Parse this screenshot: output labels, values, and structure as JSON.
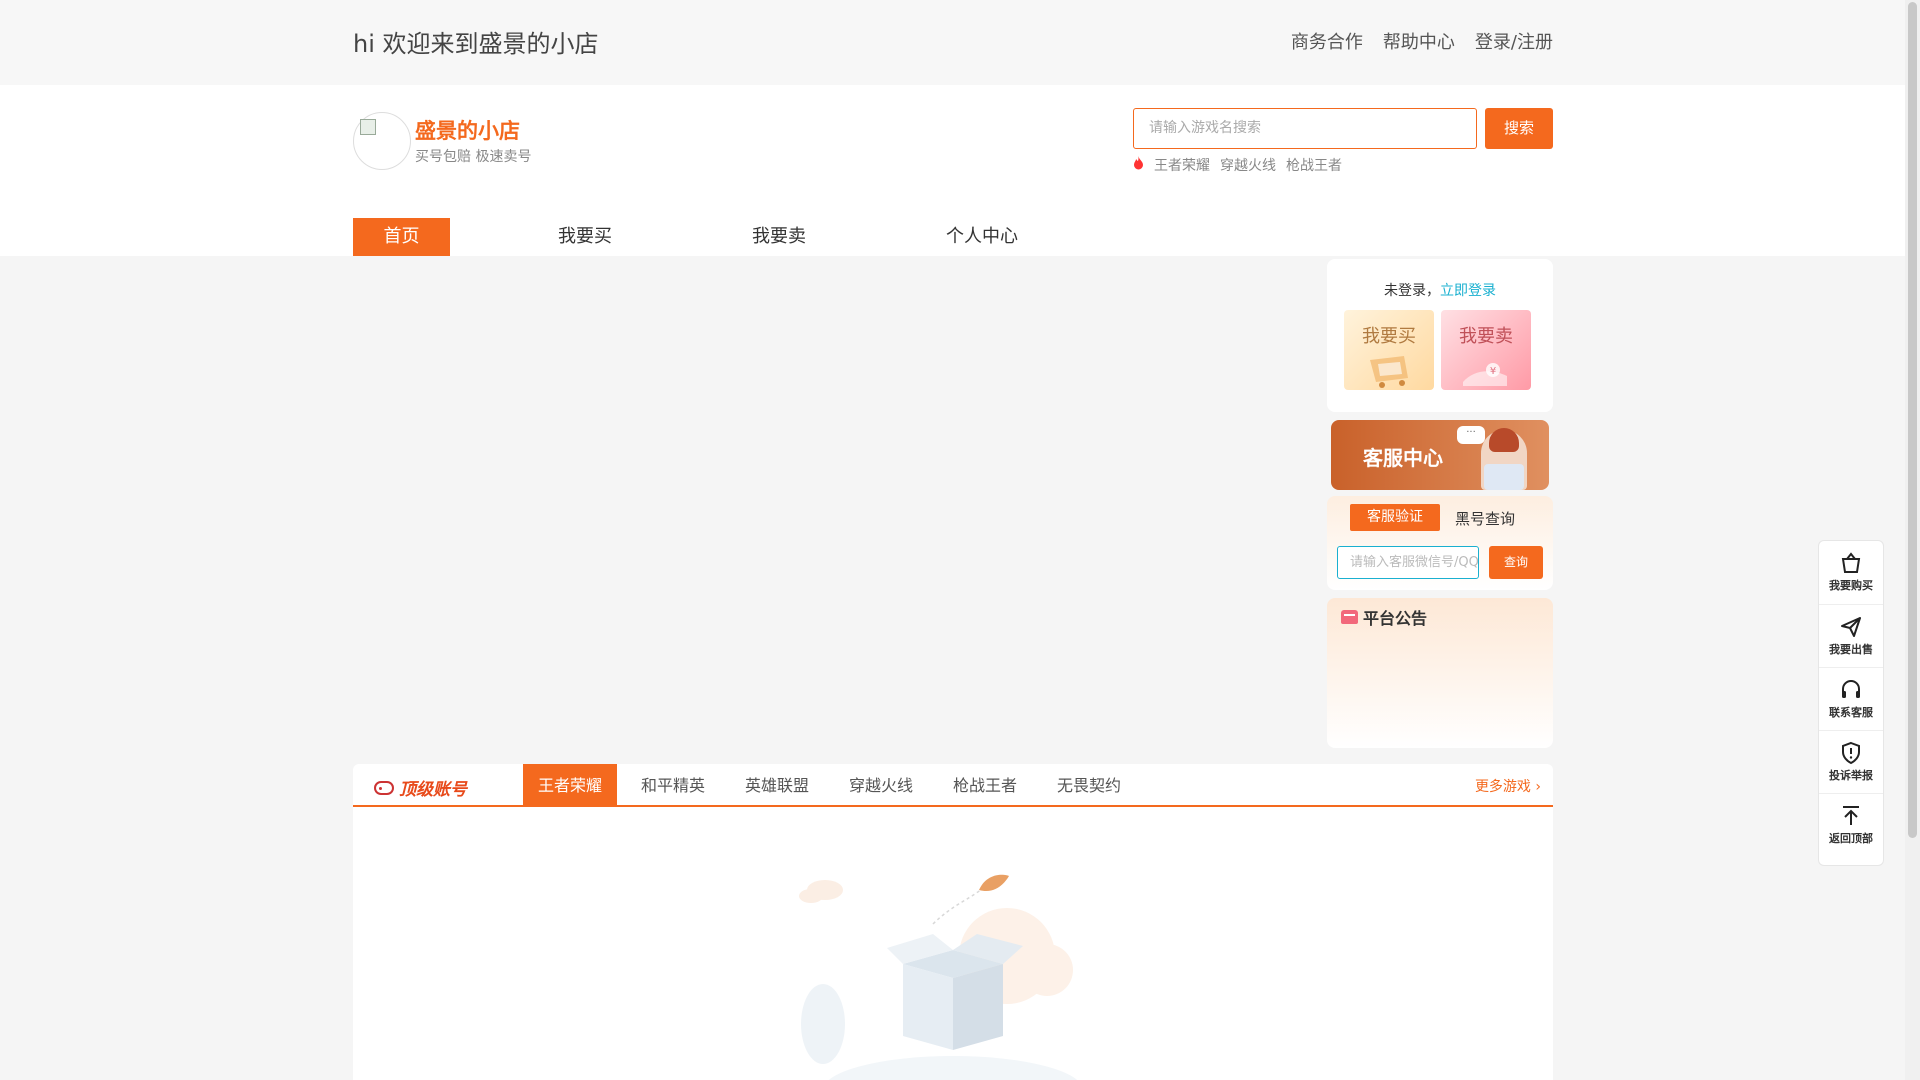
{
  "topbar": {
    "welcome": "hi 欢迎来到盛景的小店",
    "links": [
      "商务合作",
      "帮助中心",
      "登录/注册"
    ]
  },
  "header": {
    "shop_name": "盛景的小店",
    "shop_desc": "买号包赔 极速卖号",
    "search_placeholder": "请输入游戏名搜索",
    "search_button": "搜索",
    "hot_icon": "fire-icon",
    "hot_games": [
      "王者荣耀",
      "穿越火线",
      "枪战王者"
    ]
  },
  "nav": {
    "items": [
      "首页",
      "我要买",
      "我要卖",
      "个人中心"
    ],
    "active": "首页"
  },
  "login_box": {
    "status": "未登录，",
    "login_link": "立即登录",
    "buy_label": "我要买",
    "sell_label": "我要卖"
  },
  "service": {
    "banner_title": "客服中心",
    "bubble": "···",
    "tab_verify": "客服验证",
    "tab_black": "黑号查询",
    "input_placeholder": "请输入客服微信号/QQ号",
    "query_button": "查询"
  },
  "notice": {
    "title": "平台公告",
    "icon": "megaphone-icon"
  },
  "games_section": {
    "brand": "顶级账号",
    "brand_icon": "gamepad-icon",
    "tabs": [
      "王者荣耀",
      "和平精英",
      "英雄联盟",
      "穿越火线",
      "枪战王者",
      "无畏契约"
    ],
    "active_tab": "王者荣耀",
    "more": "更多游戏"
  },
  "float_bar": {
    "items": [
      {
        "label": "我要购买",
        "icon": "shopping-bag-icon"
      },
      {
        "label": "我要出售",
        "icon": "paper-plane-icon"
      },
      {
        "label": "联系客服",
        "icon": "headset-icon"
      },
      {
        "label": "投诉举报",
        "icon": "shield-alert-icon"
      },
      {
        "label": "返回顶部",
        "icon": "arrow-up-icon"
      }
    ]
  },
  "colors": {
    "accent": "#f4691e",
    "link": "#1ab0d0"
  }
}
